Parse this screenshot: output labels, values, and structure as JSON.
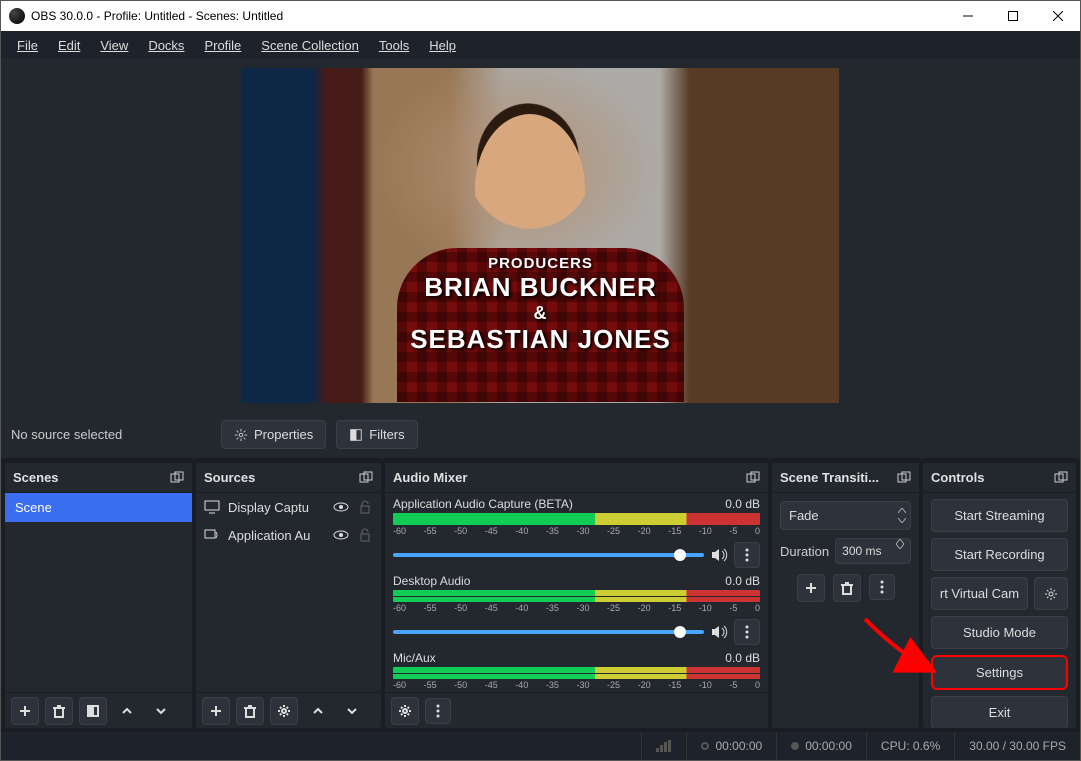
{
  "titlebar": {
    "title": "OBS 30.0.0 - Profile: Untitled - Scenes: Untitled"
  },
  "menubar": {
    "items": [
      "File",
      "Edit",
      "View",
      "Docks",
      "Profile",
      "Scene Collection",
      "Tools",
      "Help"
    ]
  },
  "preview": {
    "credits": {
      "l1": "PRODUCERS",
      "l2": "BRIAN BUCKNER",
      "l3": "&",
      "l4": "SEBASTIAN JONES"
    }
  },
  "source_toolbar": {
    "status": "No source selected",
    "properties": "Properties",
    "filters": "Filters"
  },
  "docks": {
    "scenes": {
      "title": "Scenes",
      "items": [
        "Scene"
      ]
    },
    "sources": {
      "title": "Sources",
      "items": [
        {
          "label": "Display Captu",
          "kind": "display"
        },
        {
          "label": "Application Au",
          "kind": "appaudio"
        }
      ]
    },
    "mixer": {
      "title": "Audio Mixer",
      "ticks": [
        "-60",
        "-55",
        "-50",
        "-45",
        "-40",
        "-35",
        "-30",
        "-25",
        "-20",
        "-15",
        "-10",
        "-5",
        "0"
      ],
      "channels": [
        {
          "name": "Application Audio Capture (BETA)",
          "db": "0.0 dB",
          "has_volume": true,
          "double": false
        },
        {
          "name": "Desktop Audio",
          "db": "0.0 dB",
          "has_volume": true,
          "double": true
        },
        {
          "name": "Mic/Aux",
          "db": "0.0 dB",
          "has_volume": false,
          "double": true
        }
      ]
    },
    "transitions": {
      "title": "Scene Transiti...",
      "select": "Fade",
      "duration_label": "Duration",
      "duration_value": "300 ms"
    },
    "controls": {
      "title": "Controls",
      "start_streaming": "Start Streaming",
      "start_recording": "Start Recording",
      "virtual_cam": "rt Virtual Cam",
      "studio_mode": "Studio Mode",
      "settings": "Settings",
      "exit": "Exit"
    }
  },
  "statusbar": {
    "stream_time": "00:00:00",
    "rec_time": "00:00:00",
    "cpu": "CPU: 0.6%",
    "fps": "30.00 / 30.00 FPS"
  }
}
